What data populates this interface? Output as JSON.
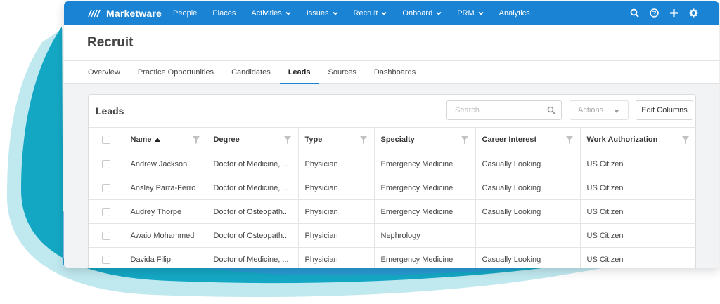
{
  "brand": {
    "name": "Marketware"
  },
  "colors": {
    "accent": "#1a83d4",
    "wave_dark": "#0fa2c1",
    "wave_light": "#bfe8ef"
  },
  "nav": {
    "items": [
      {
        "label": "People"
      },
      {
        "label": "Places"
      },
      {
        "label": "Activities",
        "dropdown": true
      },
      {
        "label": "Issues",
        "dropdown": true
      },
      {
        "label": "Recruit",
        "dropdown": true
      },
      {
        "label": "Onboard",
        "dropdown": true
      },
      {
        "label": "PRM",
        "dropdown": true
      },
      {
        "label": "Analytics"
      }
    ],
    "icons": [
      "search-icon",
      "help-icon",
      "plus-icon",
      "gear-icon"
    ]
  },
  "page": {
    "title": "Recruit"
  },
  "tabs": [
    {
      "label": "Overview"
    },
    {
      "label": "Practice Opportunities"
    },
    {
      "label": "Candidates"
    },
    {
      "label": "Leads",
      "active": true
    },
    {
      "label": "Sources"
    },
    {
      "label": "Dashboards"
    }
  ],
  "panel": {
    "title": "Leads",
    "search_placeholder": "Search",
    "actions_label": "Actions",
    "edit_columns_label": "Edit Columns"
  },
  "table": {
    "columns": [
      "Name",
      "Degree",
      "Type",
      "Specialty",
      "Career Interest",
      "Work Authorization"
    ],
    "sorted_column": "Name",
    "sort_direction": "ascending",
    "rows": [
      [
        "Andrew Jackson",
        "Doctor of Medicine, ...",
        "Physician",
        "Emergency Medicine",
        "Casually Looking",
        "US Citizen"
      ],
      [
        "Ansley Parra-Ferro",
        "Doctor of Medicine, ...",
        "Physician",
        "Emergency Medicine",
        "Casually Looking",
        "US Citizen"
      ],
      [
        "Audrey Thorpe",
        "Doctor of Osteopath...",
        "Physician",
        "Emergency Medicine",
        "Casually Looking",
        "US Citizen"
      ],
      [
        "Awaio Mohammed",
        "Doctor of Osteopath...",
        "Physician",
        "Nephrology",
        "",
        "US Citizen"
      ],
      [
        "Davida Filip",
        "Doctor of Medicine, ...",
        "Physician",
        "Emergency Medicine",
        "Casually Looking",
        "US Citizen"
      ]
    ]
  }
}
